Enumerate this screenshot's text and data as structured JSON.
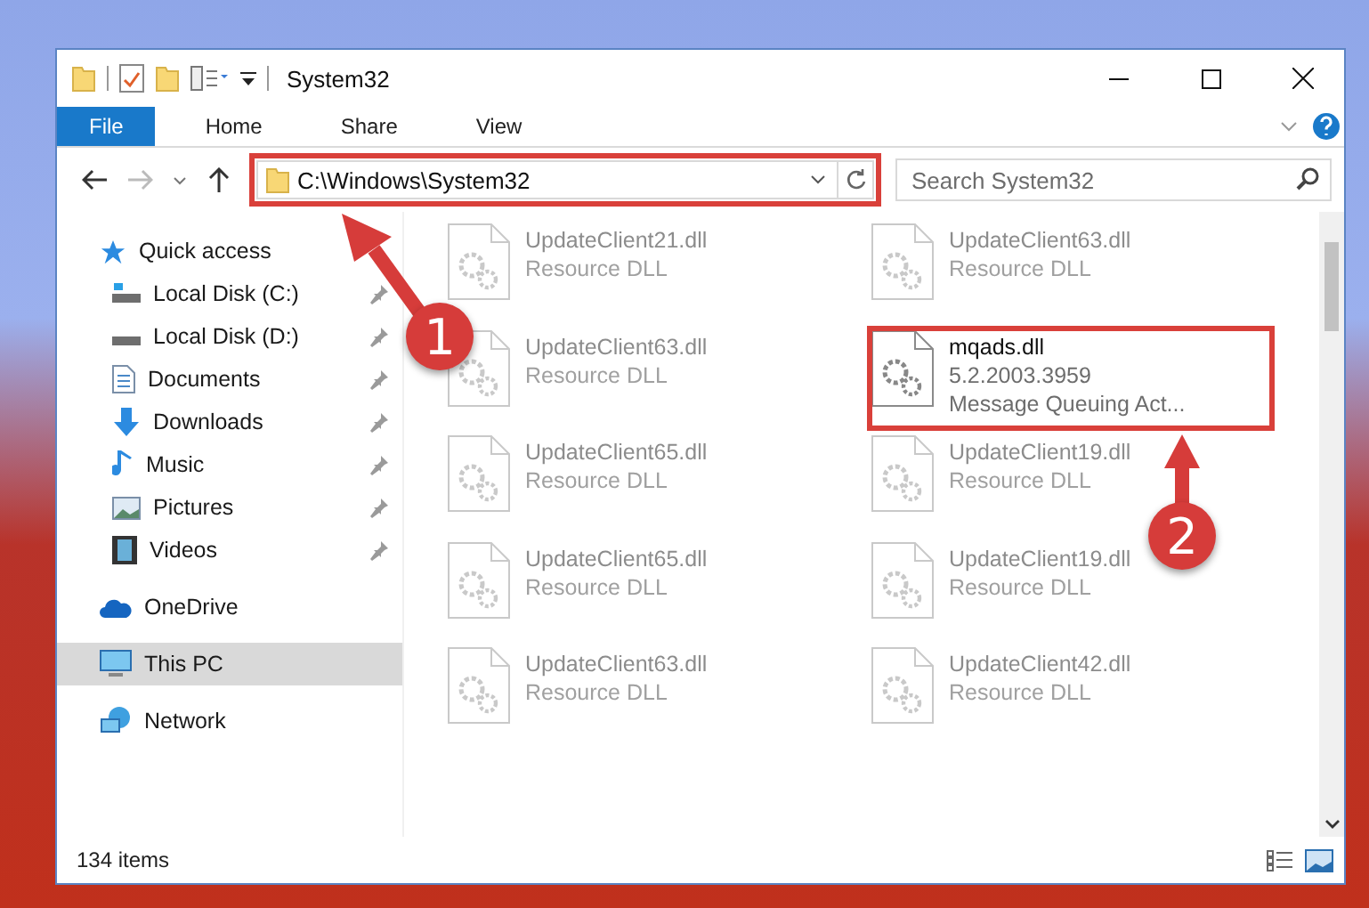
{
  "window": {
    "title": "System32"
  },
  "ribbon_tabs": [
    {
      "label": "File",
      "selected": true
    },
    {
      "label": "Home",
      "selected": false
    },
    {
      "label": "Share",
      "selected": false
    },
    {
      "label": "View",
      "selected": false
    }
  ],
  "address": {
    "value": "C:\\Windows\\System32"
  },
  "search": {
    "placeholder": "Search System32"
  },
  "nav": [
    {
      "label": "Quick access",
      "selected": false,
      "children": [
        {
          "label": "Local Disk (C:)",
          "pinned": true
        },
        {
          "label": "Local Disk (D:)",
          "pinned": true
        },
        {
          "label": "Documents",
          "pinned": true
        },
        {
          "label": "Downloads",
          "pinned": true
        },
        {
          "label": "Music",
          "pinned": true
        },
        {
          "label": "Pictures",
          "pinned": true
        },
        {
          "label": "Videos",
          "pinned": true
        }
      ]
    },
    {
      "label": "OneDrive",
      "selected": false
    },
    {
      "label": "This PC",
      "selected": true
    },
    {
      "label": "Network",
      "selected": false
    }
  ],
  "files": [
    {
      "kind": "faded",
      "name": "UpdateClient21.dll",
      "lines": [
        "Resource DLL"
      ]
    },
    {
      "kind": "faded",
      "name": "UpdateClient63.dll",
      "lines": [
        "Resource DLL"
      ]
    },
    {
      "kind": "faded",
      "name": "UpdateClient63.dll",
      "lines": [
        "Resource DLL"
      ]
    },
    {
      "kind": "normal",
      "name": "mqads.dll",
      "lines": [
        "5.2.2003.3959",
        "Message Queuing Act..."
      ]
    },
    {
      "kind": "faded",
      "name": "UpdateClient65.dll",
      "lines": [
        "Resource DLL"
      ]
    },
    {
      "kind": "faded",
      "name": "UpdateClient19.dll",
      "lines": [
        "Resource DLL"
      ]
    },
    {
      "kind": "faded",
      "name": "UpdateClient65.dll",
      "lines": [
        "Resource DLL"
      ]
    },
    {
      "kind": "faded",
      "name": "UpdateClient19.dll",
      "lines": [
        "Resource DLL"
      ]
    },
    {
      "kind": "faded",
      "name": "UpdateClient63.dll",
      "lines": [
        "Resource DLL"
      ]
    },
    {
      "kind": "faded",
      "name": "UpdateClient42.dll",
      "lines": [
        "Resource DLL"
      ]
    }
  ],
  "status_bar": {
    "item_count": "134 items"
  },
  "annotations": [
    {
      "label": "1"
    },
    {
      "label": "2"
    }
  ]
}
